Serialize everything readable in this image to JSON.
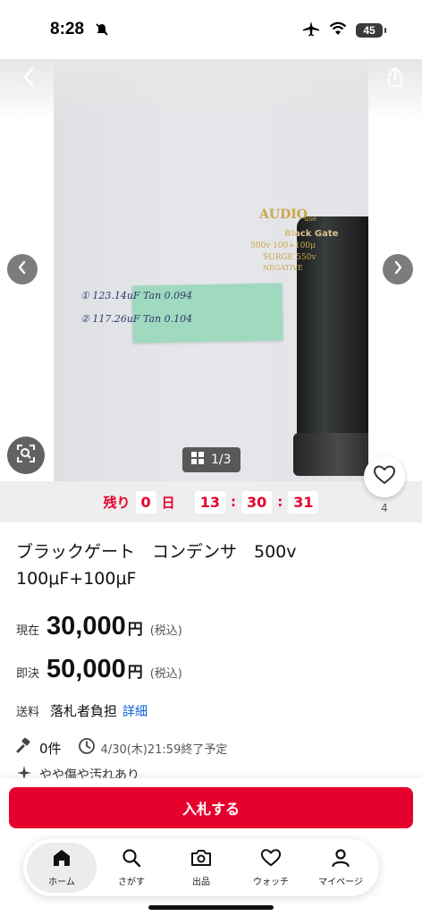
{
  "status_bar": {
    "time": "8:28",
    "battery": "45"
  },
  "gallery": {
    "counter": "1/3",
    "note_lines": [
      "① 123.14uF  Tan 0.094",
      "② 117.26uF  Tan 0.104"
    ],
    "cap_labels": [
      "AUDIO",
      "use",
      "Black Gate",
      "500v 100+100μ",
      "SURGE 550v",
      "NEGATIVE"
    ]
  },
  "countdown": {
    "prefix": "残り",
    "days": "0",
    "day_label": "日",
    "hours": "13",
    "minutes": "30",
    "seconds": "31",
    "separator": ":"
  },
  "favorite": {
    "count": "4"
  },
  "product": {
    "title": "ブラックゲート　コンデンサ　500v 100μF+100μF",
    "current_label": "現在",
    "current_price": "30,000",
    "buyout_label": "即決",
    "buyout_price": "50,000",
    "yen": "円",
    "tax_note": "(税込)",
    "shipping_label": "送料",
    "shipping_value": "落札者負担",
    "shipping_link": "詳細",
    "bid_count": "0件",
    "end_time": "4/30(木)21:59終了予定",
    "condition": "やや傷や汚れあり"
  },
  "actions": {
    "bid_button": "入札する"
  },
  "tabs": [
    {
      "label": "ホーム",
      "icon": "home-icon"
    },
    {
      "label": "さがす",
      "icon": "search-icon"
    },
    {
      "label": "出品",
      "icon": "camera-icon"
    },
    {
      "label": "ウォッチ",
      "icon": "heart-icon"
    },
    {
      "label": "マイページ",
      "icon": "person-icon"
    }
  ],
  "colors": {
    "accent": "#e6002d",
    "link": "#0b5fd6"
  }
}
